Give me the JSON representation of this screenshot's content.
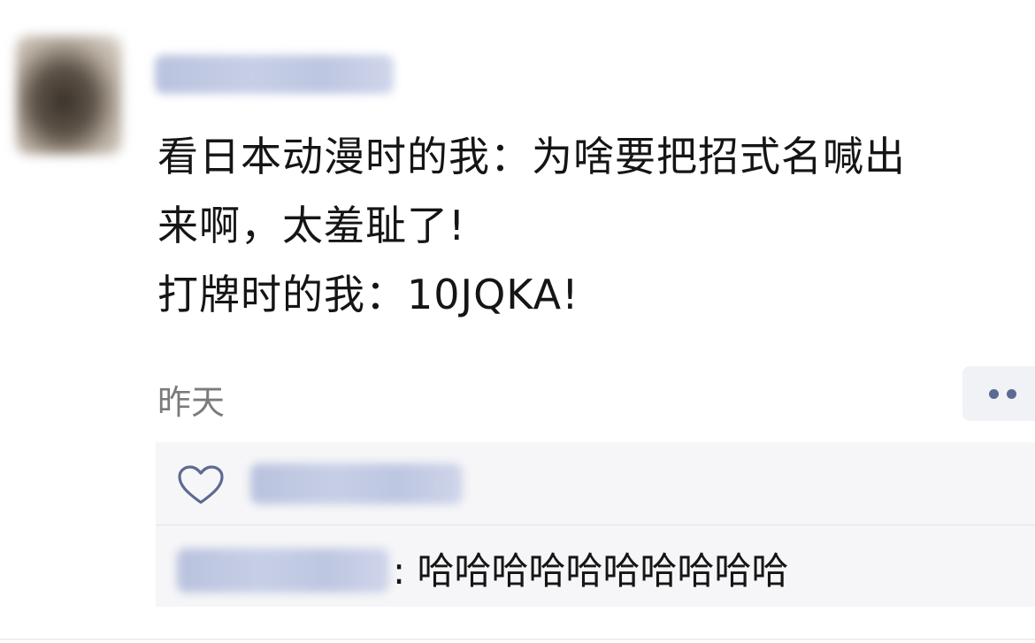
{
  "post": {
    "lines": [
      "看日本动漫时的我：为啥要把招式名喊出",
      "来啊，太羞耻了!",
      "打牌时的我：10JQKA!"
    ],
    "time": "昨天"
  },
  "comments": {
    "reply_text": ": 哈哈哈哈哈哈哈哈哈哈"
  },
  "colors": {
    "accent": "#5d6a92",
    "text": "#151515",
    "muted": "#7b7b7b",
    "comment_bg": "#f6f6f8"
  },
  "icons": [
    "heart-icon",
    "more-icon"
  ]
}
